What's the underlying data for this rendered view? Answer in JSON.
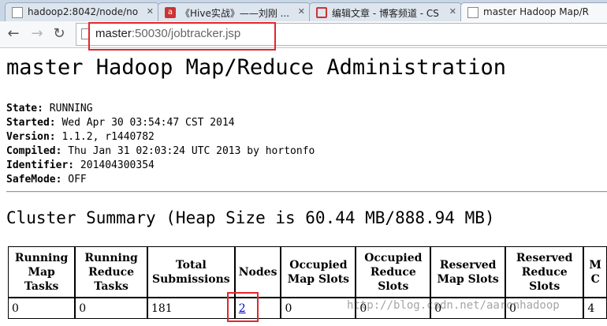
{
  "browser": {
    "tabs": [
      {
        "title": "hadoop2:8042/node/no",
        "favicon": "page-icon",
        "active": false
      },
      {
        "title": "《Hive实战》——刘刚 ...",
        "favicon": "red-book-icon",
        "active": false
      },
      {
        "title": "编辑文章 - 博客频道 - CS",
        "favicon": "csdn-icon",
        "active": false
      },
      {
        "title": "master Hadoop Map/R",
        "favicon": "page-icon",
        "active": true
      }
    ],
    "url_host": "master",
    "url_rest": ":50030/jobtracker.jsp"
  },
  "page": {
    "title": "master Hadoop Map/Reduce Administration",
    "info": [
      {
        "label": "State:",
        "value": "RUNNING"
      },
      {
        "label": "Started:",
        "value": "Wed Apr 30 03:54:47 CST 2014"
      },
      {
        "label": "Version:",
        "value": "1.1.2, r1440782"
      },
      {
        "label": "Compiled:",
        "value": "Thu Jan 31 02:03:24 UTC 2013 by hortonfo"
      },
      {
        "label": "Identifier:",
        "value": "201404300354"
      },
      {
        "label": "SafeMode:",
        "value": "OFF"
      }
    ],
    "summary_heading": "Cluster Summary (Heap Size is 60.44 MB/888.94 MB)",
    "table": {
      "headers": [
        "Running Map Tasks",
        "Running Reduce Tasks",
        "Total Submissions",
        "Nodes",
        "Occupied Map Slots",
        "Occupied Reduce Slots",
        "Reserved Map Slots",
        "Reserved Reduce Slots",
        "M C"
      ],
      "row": [
        "0",
        "0",
        "181",
        "2",
        "0",
        "0",
        "0",
        "0",
        "4"
      ]
    },
    "watermark": "http://blog.csdn.net/aaronhadoop"
  },
  "colors": {
    "highlight": "#e4262c",
    "link": "#0000cc",
    "tabstrip": "#c9d6e6"
  }
}
